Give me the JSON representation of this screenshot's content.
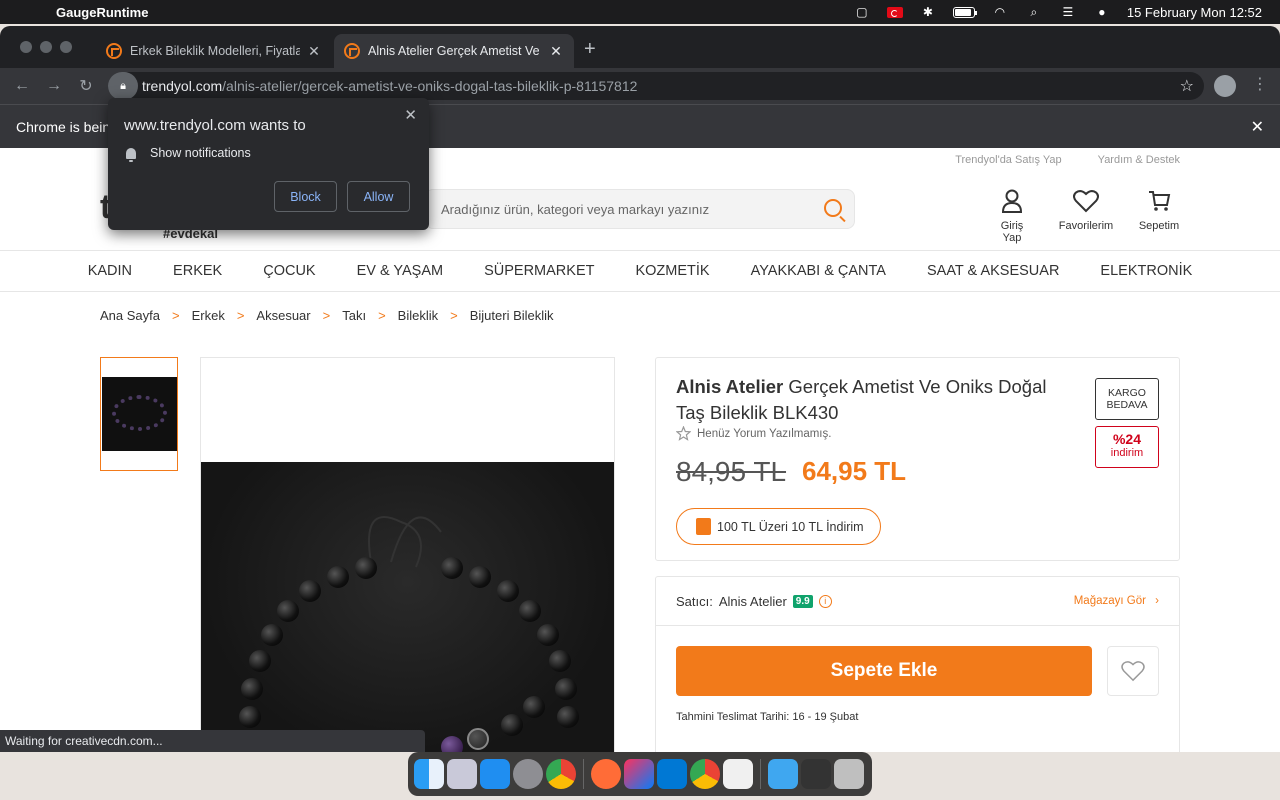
{
  "menubar": {
    "app_name": "GaugeRuntime",
    "datetime": "15 February Mon  12:52"
  },
  "tabs": [
    {
      "title": "Erkek Bileklik Modelleri, Fiyatla"
    },
    {
      "title": "Alnis Atelier Gerçek Ametist Ve"
    }
  ],
  "omnibox": {
    "host": "trendyol.com",
    "path": "/alnis-atelier/gercek-ametist-ve-oniks-dogal-tas-bileklik-p-81157812"
  },
  "infobar": {
    "text": "Chrome is bein"
  },
  "permission_popup": {
    "title": "www.trendyol.com wants to",
    "permission": "Show notifications",
    "block_label": "Block",
    "allow_label": "Allow"
  },
  "site_header": {
    "top_links": [
      "Trendyol'da Satış Yap",
      "Yardım & Destek"
    ],
    "logo_letter": "t",
    "logo_tag": "#evdekal",
    "search_placeholder": "Aradığınız ürün, kategori veya markayı yazınız",
    "actions": [
      "Giriş Yap",
      "Favorilerim",
      "Sepetim"
    ]
  },
  "categories": [
    "KADIN",
    "ERKEK",
    "ÇOCUK",
    "EV & YAŞAM",
    "SÜPERMARKET",
    "KOZMETİK",
    "AYAKKABI & ÇANTA",
    "SAAT & AKSESUAR",
    "ELEKTRONİK"
  ],
  "breadcrumb": [
    "Ana Sayfa",
    "Erkek",
    "Aksesuar",
    "Takı",
    "Bileklik",
    "Bijuteri Bileklik"
  ],
  "product": {
    "brand": "Alnis Atelier",
    "name": " Gerçek Ametist Ve Oniks Doğal Taş Bileklik BLK430",
    "reviews": "Henüz Yorum Yazılmamış.",
    "kargo_line1": "KARGO",
    "kargo_line2": "BEDAVA",
    "discount_pct": "%24",
    "discount_label": "indirim",
    "old_price": "84,95 TL",
    "new_price": "64,95 TL",
    "promo": "100 TL Üzeri 10 TL İndirim"
  },
  "seller": {
    "label": "Satıcı:",
    "name": "Alnis Atelier",
    "score": "9.9",
    "store_link": "Mağazayı Gör",
    "add_to_cart": "Sepete Ekle",
    "delivery": "Tahmini Teslimat Tarihi: 16 - 19 Şubat"
  },
  "status_bar": "Waiting for creativecdn.com...",
  "colors": {
    "brand_orange": "#f27a1a",
    "discount_red": "#d0021b",
    "seller_score_green": "#10a36c"
  }
}
